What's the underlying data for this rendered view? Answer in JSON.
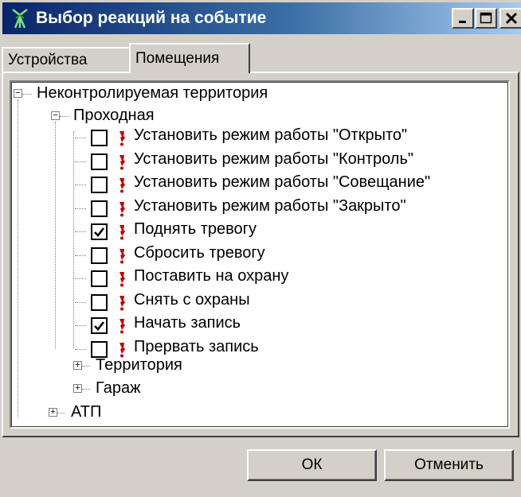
{
  "window": {
    "title": "Выбор реакций на событие",
    "controls": {
      "minimize": "_",
      "maximize": "□",
      "close": "×"
    }
  },
  "tabs": [
    {
      "label": "Устройства",
      "active": false
    },
    {
      "label": "Помещения",
      "active": true
    }
  ],
  "tree": {
    "root": {
      "label": "Неконтролируемая территория",
      "expanded": true
    },
    "room": {
      "label": "Проходная",
      "expanded": true
    },
    "reactions": [
      {
        "label": "Установить режим работы \"Открыто\"",
        "checked": false
      },
      {
        "label": "Установить режим работы \"Контроль\"",
        "checked": false
      },
      {
        "label": "Установить режим работы \"Совещание\"",
        "checked": false
      },
      {
        "label": "Установить режим работы \"Закрыто\"",
        "checked": false
      },
      {
        "label": "Поднять тревогу",
        "checked": true
      },
      {
        "label": "Сбросить тревогу",
        "checked": false
      },
      {
        "label": "Поставить на охрану",
        "checked": false
      },
      {
        "label": "Снять с охраны",
        "checked": false
      },
      {
        "label": "Начать запись",
        "checked": true
      },
      {
        "label": "Прервать запись",
        "checked": false
      }
    ],
    "collapsed_rooms": [
      {
        "label": "Территория"
      },
      {
        "label": "Гараж"
      }
    ],
    "other_root": {
      "label": "АТП"
    }
  },
  "buttons": {
    "ok": "ОК",
    "cancel": "Отменить"
  },
  "colors": {
    "titlebar_start": "#0a246a",
    "titlebar_end": "#a6caf0",
    "face": "#d4d0c8",
    "reaction_icon": "#c00000"
  }
}
